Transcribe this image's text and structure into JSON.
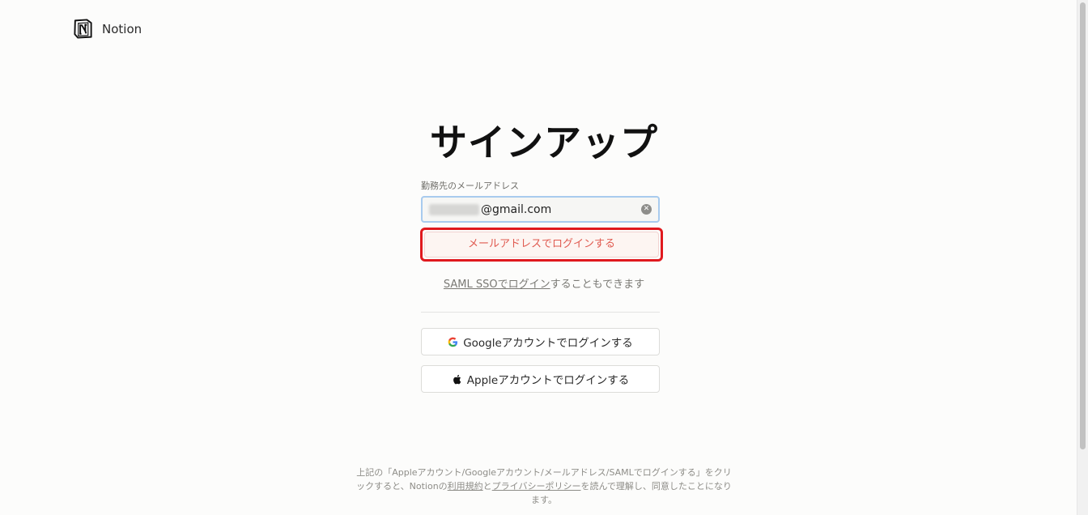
{
  "header": {
    "brand": "Notion",
    "logo_icon": "notion-logo-icon"
  },
  "title": "サインアップ",
  "form": {
    "email_label": "勤務先のメールアドレス",
    "email_value": "@gmail.com",
    "clear_icon": "clear-icon",
    "login_email_label": "メールアドレスでログインする"
  },
  "saml": {
    "link_text": "SAML SSOでログイン",
    "suffix_text": "することもできます"
  },
  "oauth": {
    "google_label": "Googleアカウントでログインする",
    "google_icon": "google-icon",
    "apple_label": "Appleアカウントでログインする",
    "apple_icon": "apple-icon"
  },
  "legal": {
    "part1": "上記の「Appleアカウント/Googleアカウント/メールアドレス/SAMLでログインする」をクリックすると、Notionの",
    "terms_link": "利用規約",
    "part2": "と",
    "privacy_link": "プライバシーポリシー",
    "part3": "を読んで理解し、同意したことになります。"
  },
  "colors": {
    "accent_red": "#e0191e",
    "login_text": "#e05a50",
    "input_focus": "#a8cbee",
    "background": "#fcfcfb"
  }
}
